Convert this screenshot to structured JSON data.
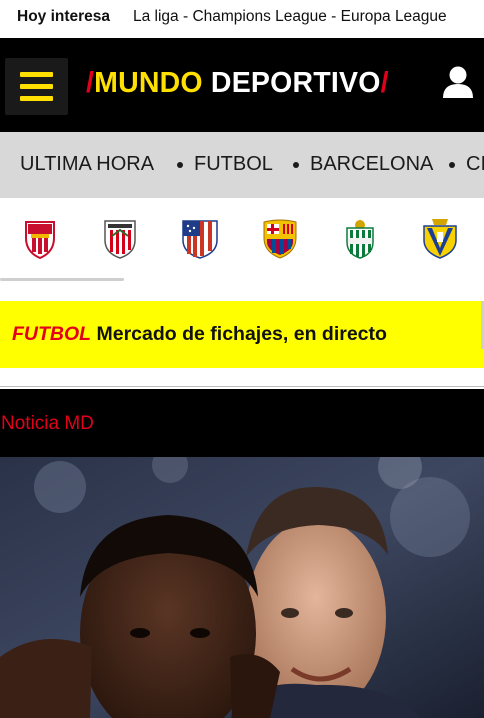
{
  "hoy_interesa": {
    "label": "Hoy interesa",
    "links": "La liga - Champions League - Europa League"
  },
  "header": {
    "menu_icon": "hamburger-menu-icon",
    "logo": {
      "slash_left": "/",
      "word1": "MUNDO",
      "word2": "DEPORTIVO",
      "slash_right": "/"
    },
    "user_icon": "user-account-icon",
    "colors": {
      "accent_yellow": "#ffe000",
      "accent_red": "#e2001a",
      "background": "#000000"
    }
  },
  "section_nav": {
    "items": [
      {
        "label": "ULTIMA HORA"
      },
      {
        "label": "FUTBOL"
      },
      {
        "label": "BARCELONA"
      },
      {
        "label": "CI"
      }
    ]
  },
  "team_crests": [
    {
      "name": "almeria-crest-icon"
    },
    {
      "name": "athletic-club-crest-icon"
    },
    {
      "name": "atletico-madrid-crest-icon"
    },
    {
      "name": "fc-barcelona-crest-icon"
    },
    {
      "name": "real-betis-crest-icon"
    },
    {
      "name": "cadiz-crest-icon"
    }
  ],
  "breaking": {
    "tag": "FUTBOL",
    "title": "Mercado de fichajes, en directo"
  },
  "noticia": {
    "label": "Noticia MD"
  },
  "hero_image": {
    "icon": "article-photo-image"
  }
}
